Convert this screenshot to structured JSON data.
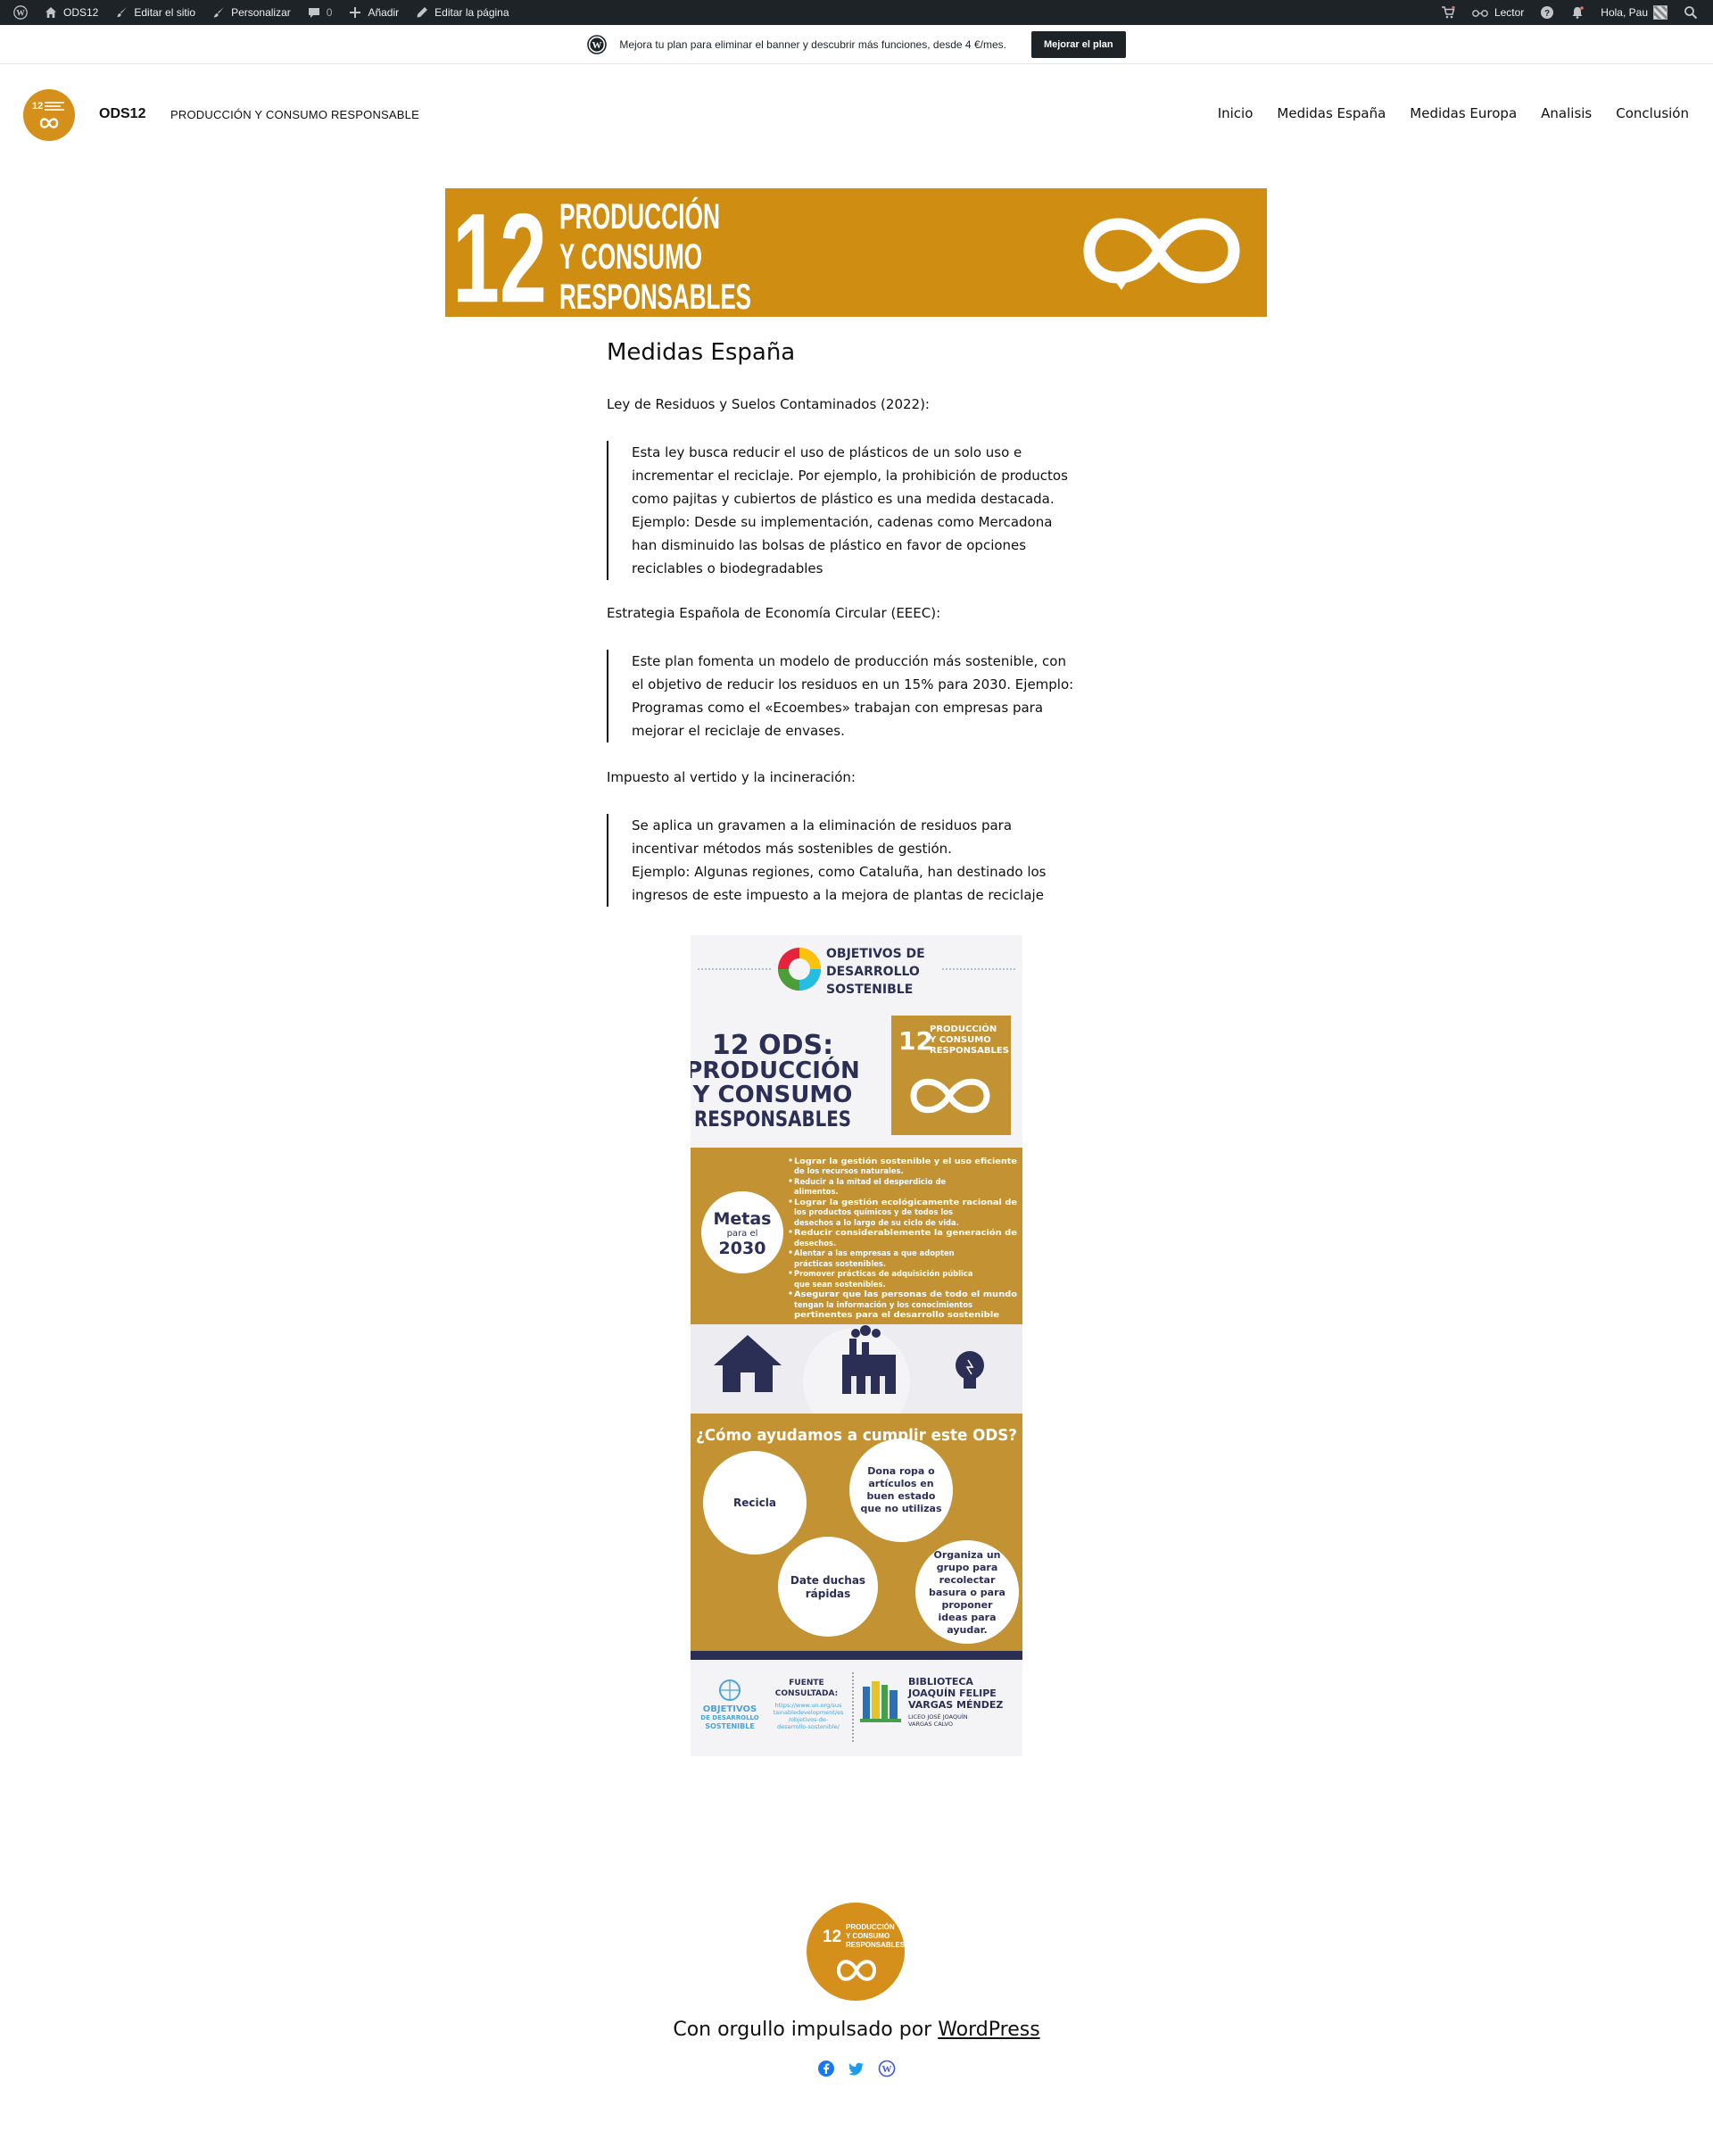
{
  "adminbar": {
    "site_name": "ODS12",
    "edit_site": "Editar el sitio",
    "customize": "Personalizar",
    "comments_count": "0",
    "add_new": "Añadir",
    "edit_page": "Editar la página",
    "reader": "Lector",
    "greeting": "Hola, Pau"
  },
  "promo": {
    "text": "Mejora tu plan para eliminar el banner y descubrir más funciones, desde 4 €/mes.",
    "button": "Mejorar el plan"
  },
  "header": {
    "site_title": "ODS12",
    "tagline": "PRODUCCIÓN Y CONSUMO RESPONSABLE",
    "nav": [
      "Inicio",
      "Medidas España",
      "Medidas Europa",
      "Analisis",
      "Conclusión"
    ]
  },
  "hero": {
    "number": "12",
    "line1": "PRODUCCIÓN",
    "line2": "Y CONSUMO",
    "line3": "RESPONSABLES"
  },
  "content": {
    "title": "Medidas España",
    "sections": [
      {
        "heading": " Ley de Residuos y Suelos Contaminados (2022):",
        "quote_lines": [
          "Esta ley busca reducir el uso de plásticos de un solo uso e",
          "incrementar el reciclaje. Por ejemplo, la prohibición de productos",
          "como pajitas y cubiertos de plástico es una medida destacada.",
          "Ejemplo: Desde su implementación, cadenas como Mercadona",
          "han disminuido las bolsas de plástico en favor de opciones",
          "reciclables o biodegradables"
        ]
      },
      {
        "heading": "Estrategia Española de Economía Circular (EEEC):",
        "quote_lines": [
          "Este plan fomenta un modelo de producción más sostenible, con",
          "el objetivo de reducir los residuos en un 15% para 2030. Ejemplo:",
          "Programas como el «Ecoembes» trabajan con empresas para",
          "mejorar el reciclaje de envases."
        ]
      },
      {
        "heading": " Impuesto al vertido y la incineración:",
        "quote_lines": [
          "Se aplica un gravamen a la eliminación de residuos para",
          "incentivar métodos más sostenibles de gestión.",
          "Ejemplo: Algunas regiones, como Cataluña, han destinado los",
          "ingresos de este impuesto a la mejora de plantas de reciclaje"
        ]
      }
    ]
  },
  "infographic": {
    "header_l1": "OBJETIVOS DE",
    "header_l2": "DESARROLLO",
    "header_l3": "SOSTENIBLE",
    "title_l1": "12 ODS:",
    "title_l2": "PRODUCCIÓN",
    "title_l3": "Y CONSUMO",
    "title_l4": "RESPONSABLES",
    "badge_number": "12",
    "badge_l1": "PRODUCCIÓN",
    "badge_l2": "Y CONSUMO",
    "badge_l3": "RESPONSABLES",
    "metas_word": "Metas",
    "metas_para": "para el",
    "metas_year": "2030",
    "goals": [
      "Lograr la gestión sostenible y el uso eficiente",
      "de los recursos naturales.",
      "Reducir a la mitad el desperdicio de",
      "alimentos.",
      "Lograr la gestión ecológicamente racional de",
      "los productos químicos y de todos los",
      "desechos a lo largo de su ciclo de vida.",
      "Reducir considerablemente la generación de",
      "desechos.",
      "Alentar a las empresas a que adopten",
      "prácticas sostenibles.",
      "Promover prácticas de adquisición pública",
      "que sean sostenibles.",
      "Asegurar que las personas de todo el mundo",
      "tengan la información y los conocimientos",
      "pertinentes para el desarrollo sostenible"
    ],
    "question": "¿Cómo ayudamos a cumplir este ODS?",
    "circle1": "Recicla",
    "circle2_l1": "Dona ropa o",
    "circle2_l2": "artículos en",
    "circle2_l3": "buen estado",
    "circle2_l4": "que no utilizas",
    "circle3_l1": "Date duchas",
    "circle3_l2": "rápidas",
    "circle4_l1": "Organiza un",
    "circle4_l2": "grupo para",
    "circle4_l3": "recolectar",
    "circle4_l4": "basura o para",
    "circle4_l5": "proponer",
    "circle4_l6": "ideas para",
    "circle4_l7": "ayudar.",
    "footer_ods_l1": "OBJETIVOS",
    "footer_ods_l2": "DE DESARROLLO",
    "footer_ods_l3": "SOSTENIBLE",
    "fuente_l1": "FUENTE",
    "fuente_l2": "CONSULTADA:",
    "url_l1": "https://www.un.org/sus",
    "url_l2": "tainabledevelopment/es",
    "url_l3": "/objetivos-de-",
    "url_l4": "desarrollo-sostenible/",
    "library_l1": "BIBLIOTECA",
    "library_l2": "JOAQUÍN FELIPE",
    "library_l3": "VARGAS MÉNDEZ",
    "school_l1": "LICEO JOSÉ JOAQUÍN",
    "school_l2": "VARGAS CALVO"
  },
  "footer": {
    "credit_prefix": "Con orgullo impulsado por ",
    "credit_link": "WordPress",
    "logo_number": "12",
    "logo_l1": "PRODUCCIÓN",
    "logo_l2": "Y CONSUMO",
    "logo_l3": "RESPONSABLES"
  },
  "colors": {
    "accent": "#cf8d12",
    "infographic_gold": "#c39232",
    "navy": "#2b2f55",
    "adminbar": "#1d2327",
    "social_blue": "#1877f2"
  }
}
